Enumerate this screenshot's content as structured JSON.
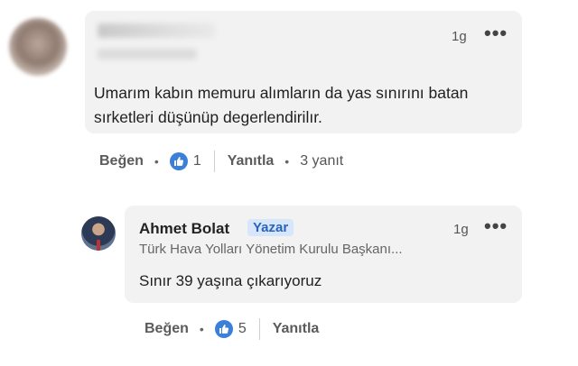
{
  "comment": {
    "time": "1g",
    "more": "•••",
    "text": "Umarım kabın memuru alımların da yas sınırını batan sırketleri düşünüp degerlendirilır.",
    "actions": {
      "like_label": "Beğen",
      "like_count": "1",
      "reply_label": "Yanıtla",
      "replies": "3 yanıt"
    }
  },
  "reply": {
    "author": "Ahmet Bolat",
    "badge": "Yazar",
    "time": "1g",
    "more": "•••",
    "headline": "Türk Hava Yolları Yönetim Kurulu Başkanı...",
    "text": "Sınır 39 yaşına çıkarıyoruz",
    "actions": {
      "like_label": "Beğen",
      "like_count": "5",
      "reply_label": "Yanıtla"
    }
  },
  "colors": {
    "bubble": "#f2f2f2",
    "like_blue": "#3b7fd8",
    "badge_bg": "#d7e6fb",
    "badge_text": "#2b63b8"
  },
  "dot": "•"
}
